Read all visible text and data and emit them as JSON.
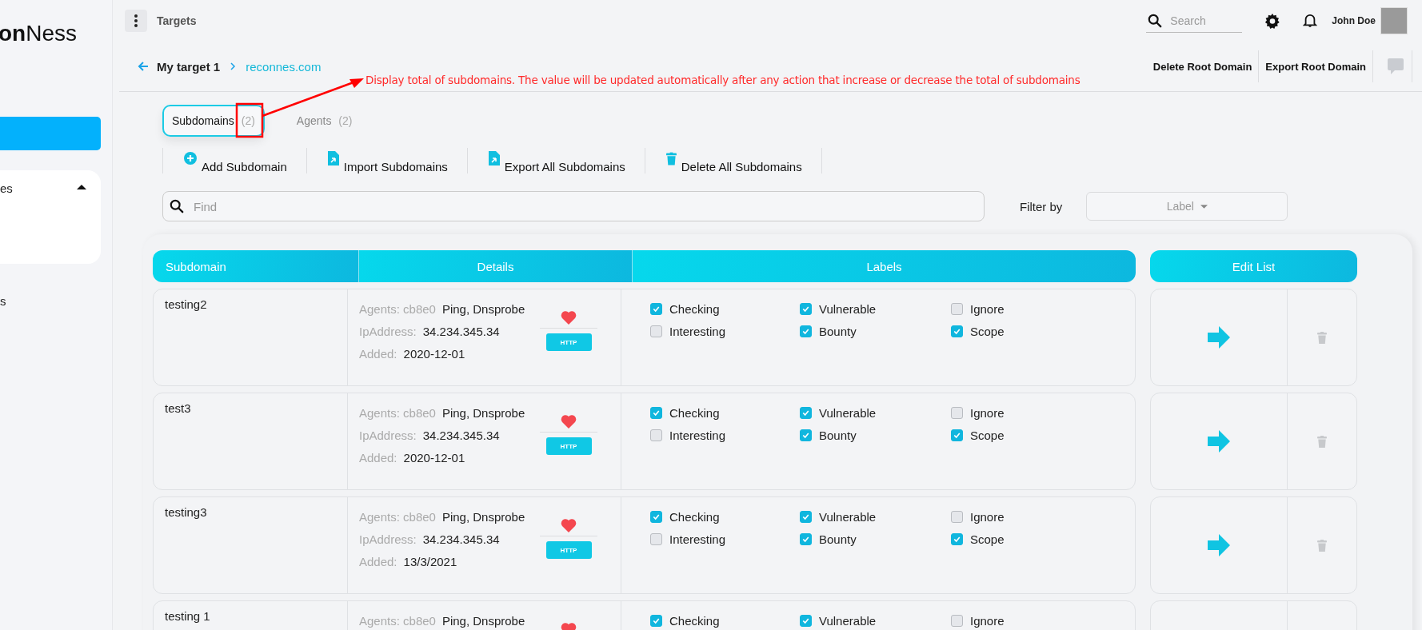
{
  "sidebar": {
    "logo": "**on**Ness",
    "group": {
      "label": "es",
      "expanded": true
    },
    "item": "s"
  },
  "header": {
    "title": "Targets",
    "search": {
      "placeholder": "Search"
    },
    "user": "John Doe"
  },
  "breadcrumb": {
    "current": "My target 1",
    "link": "reconnes.com"
  },
  "actions": [
    "Delete Root Domain",
    "Export Root Domain"
  ],
  "annotation": {
    "text": "Display total of subdomains. The value will be updated automatically after any action that increase or decrease the total of subdomains"
  },
  "tabs": [
    {
      "label": "Subdomains",
      "count": "(2)",
      "selected": true
    },
    {
      "label": "Agents",
      "count": "(2)",
      "selected": false
    }
  ],
  "toolbar": [
    {
      "kind": "add",
      "label": "Add Subdomain"
    },
    {
      "kind": "import",
      "label": "Import Subdomains"
    },
    {
      "kind": "export",
      "label": "Export All Subdomains"
    },
    {
      "kind": "delete",
      "label": "Delete All Subdomains"
    }
  ],
  "find": {
    "placeholder": "Find"
  },
  "filter": {
    "label": "Filter by",
    "placeholder": "Label"
  },
  "table": {
    "columns": [
      "Subdomain",
      "Details",
      "Labels"
    ],
    "edit_column": "Edit List",
    "rows": [
      {
        "name": "testing2",
        "agents_label": "Agents: cb8e0",
        "agents": "Ping, Dnsprobe",
        "ip_label": "IpAddress:",
        "ip": "34.234.345.34",
        "added_label": "Added:",
        "added": "2020-12-01",
        "badge": "HTTP",
        "labels": [
          {
            "name": "Checking",
            "checked": true
          },
          {
            "name": "Vulnerable",
            "checked": true
          },
          {
            "name": "Ignore",
            "checked": false
          },
          {
            "name": "Interesting",
            "checked": false
          },
          {
            "name": "Bounty",
            "checked": true
          },
          {
            "name": "Scope",
            "checked": true
          }
        ]
      },
      {
        "name": "test3",
        "agents_label": "Agents: cb8e0",
        "agents": "Ping, Dnsprobe",
        "ip_label": "IpAddress:",
        "ip": "34.234.345.34",
        "added_label": "Added:",
        "added": "2020-12-01",
        "badge": "HTTP",
        "labels": [
          {
            "name": "Checking",
            "checked": true
          },
          {
            "name": "Vulnerable",
            "checked": true
          },
          {
            "name": "Ignore",
            "checked": false
          },
          {
            "name": "Interesting",
            "checked": false
          },
          {
            "name": "Bounty",
            "checked": true
          },
          {
            "name": "Scope",
            "checked": true
          }
        ]
      },
      {
        "name": "testing3",
        "agents_label": "Agents: cb8e0",
        "agents": "Ping, Dnsprobe",
        "ip_label": "IpAddress:",
        "ip": "34.234.345.34",
        "added_label": "Added:",
        "added": "13/3/2021",
        "badge": "HTTP",
        "labels": [
          {
            "name": "Checking",
            "checked": true
          },
          {
            "name": "Vulnerable",
            "checked": true
          },
          {
            "name": "Ignore",
            "checked": false
          },
          {
            "name": "Interesting",
            "checked": false
          },
          {
            "name": "Bounty",
            "checked": true
          },
          {
            "name": "Scope",
            "checked": true
          }
        ]
      },
      {
        "name": "testing 1",
        "agents_label": "Agents: cb8e0",
        "agents": "Ping, Dnsprobe",
        "labels": [
          {
            "name": "Checking",
            "checked": true
          },
          {
            "name": "Vulnerable",
            "checked": true
          },
          {
            "name": "Ignore",
            "checked": false
          }
        ]
      }
    ]
  }
}
